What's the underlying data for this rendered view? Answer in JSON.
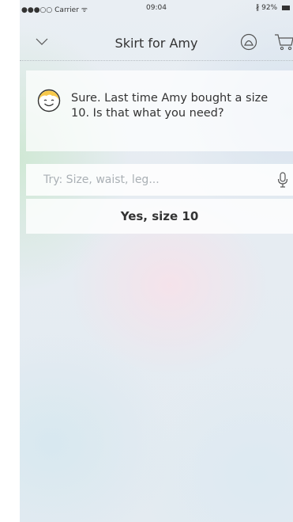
{
  "status_bar": {
    "signal": "●●●○○",
    "carrier": "Carrier",
    "wifi": "ᯤ",
    "time": "09:04",
    "bluetooth": "∦",
    "battery": "92%"
  },
  "nav": {
    "title": "Skirt for Amy",
    "back_icon": "chevron-down-icon",
    "bot_icon": "bot-icon",
    "cart_icon": "cart-icon"
  },
  "chat": {
    "avatar_icon": "smiley-avatar",
    "message": "Sure. Last time Amy bought a size 10. Is that what you need?"
  },
  "input": {
    "placeholder": "Try: Size, waist, leg...",
    "value": "",
    "mic_icon": "microphone-icon"
  },
  "suggestion": {
    "label": "Yes, size 10"
  },
  "colors": {
    "avatar_fill": "#f7c94b",
    "text": "#333333"
  }
}
